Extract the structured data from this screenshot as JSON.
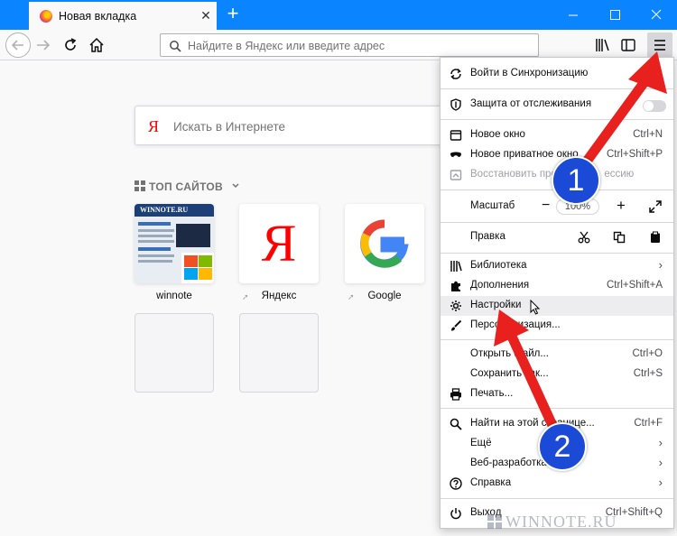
{
  "tab": {
    "title": "Новая вкладка",
    "close_glyph": "✕",
    "new_glyph": "+"
  },
  "window": {
    "min_glyph": "—",
    "max_glyph": "☐",
    "close_glyph": "✕"
  },
  "navbar": {
    "url_placeholder": "Найдите в Яндекс или введите адрес"
  },
  "search": {
    "logo": "Я",
    "placeholder": "Искать в Интернете"
  },
  "topsites": {
    "header": "ТОП САЙТОВ",
    "tiles": [
      {
        "label": "winnote",
        "image_text": "WINNOTE.RU"
      },
      {
        "label": "Яндекс",
        "image_text": "Я"
      },
      {
        "label": "Google",
        "image_text": "G"
      }
    ]
  },
  "menu": {
    "sync": "Войти в Синхронизацию",
    "tracking": "Защита от отслеживания",
    "new_window": "Новое окно",
    "new_window_short": "Ctrl+N",
    "private_window": "Новое приватное окно",
    "private_window_short": "Ctrl+Shift+P",
    "restore_prefix": "Восстановить пред",
    "restore_suffix": "ессию",
    "zoom_label": "Масштаб",
    "zoom_minus": "−",
    "zoom_value": "100%",
    "zoom_plus": "+",
    "edit_label": "Правка",
    "library": "Библиотека",
    "addons": "Дополнения",
    "addons_short": "Ctrl+Shift+A",
    "settings": "Настройки",
    "customize": "Персонализация...",
    "open_file": "Открыть файл...",
    "open_file_short": "Ctrl+O",
    "save_as": "Сохранить как...",
    "save_as_short": "Ctrl+S",
    "print": "Печать...",
    "find": "Найти на этой странице...",
    "find_short": "Ctrl+F",
    "more": "Ещё",
    "webdev": "Веб-разработка",
    "help": "Справка",
    "exit": "Выход",
    "exit_short": "Ctrl+Shift+Q",
    "arrow": "›"
  },
  "annotations": {
    "badge1": "1",
    "badge2": "2",
    "arrow_color": "#e8201e",
    "badge_color": "#1a4ad6"
  },
  "watermark": "WINNOTE.RU",
  "colors": {
    "accent": "#0a84ff"
  }
}
